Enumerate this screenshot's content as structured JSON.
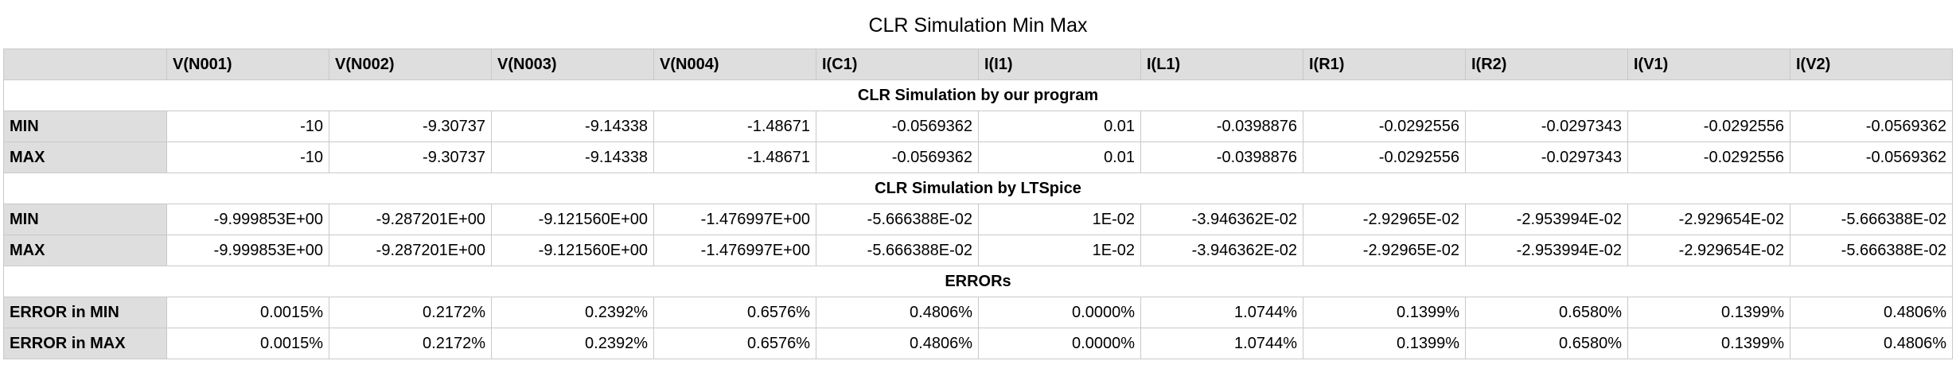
{
  "title": "CLR Simulation Min Max",
  "columns": [
    "V(N001)",
    "V(N002)",
    "V(N003)",
    "V(N004)",
    "I(C1)",
    "I(I1)",
    "I(L1)",
    "I(R1)",
    "I(R2)",
    "I(V1)",
    "I(V2)"
  ],
  "sections": [
    {
      "heading": "CLR Simulation by our program",
      "rows": [
        {
          "label": "MIN",
          "values": [
            "-10",
            "-9.30737",
            "-9.14338",
            "-1.48671",
            "-0.0569362",
            "0.01",
            "-0.0398876",
            "-0.0292556",
            "-0.0297343",
            "-0.0292556",
            "-0.0569362"
          ]
        },
        {
          "label": "MAX",
          "values": [
            "-10",
            "-9.30737",
            "-9.14338",
            "-1.48671",
            "-0.0569362",
            "0.01",
            "-0.0398876",
            "-0.0292556",
            "-0.0297343",
            "-0.0292556",
            "-0.0569362"
          ]
        }
      ]
    },
    {
      "heading": "CLR Simulation by LTSpice",
      "rows": [
        {
          "label": "MIN",
          "values": [
            "-9.999853E+00",
            "-9.287201E+00",
            "-9.121560E+00",
            "-1.476997E+00",
            "-5.666388E-02",
            "1E-02",
            "-3.946362E-02",
            "-2.92965E-02",
            "-2.953994E-02",
            "-2.929654E-02",
            "-5.666388E-02"
          ]
        },
        {
          "label": "MAX",
          "values": [
            "-9.999853E+00",
            "-9.287201E+00",
            "-9.121560E+00",
            "-1.476997E+00",
            "-5.666388E-02",
            "1E-02",
            "-3.946362E-02",
            "-2.92965E-02",
            "-2.953994E-02",
            "-2.929654E-02",
            "-5.666388E-02"
          ]
        }
      ]
    },
    {
      "heading": "ERRORs",
      "rows": [
        {
          "label": "ERROR in MIN",
          "values": [
            "0.0015%",
            "0.2172%",
            "0.2392%",
            "0.6576%",
            "0.4806%",
            "0.0000%",
            "1.0744%",
            "0.1399%",
            "0.6580%",
            "0.1399%",
            "0.4806%"
          ]
        },
        {
          "label": "ERROR in MAX",
          "values": [
            "0.0015%",
            "0.2172%",
            "0.2392%",
            "0.6576%",
            "0.4806%",
            "0.0000%",
            "1.0744%",
            "0.1399%",
            "0.6580%",
            "0.1399%",
            "0.4806%"
          ]
        }
      ]
    }
  ]
}
